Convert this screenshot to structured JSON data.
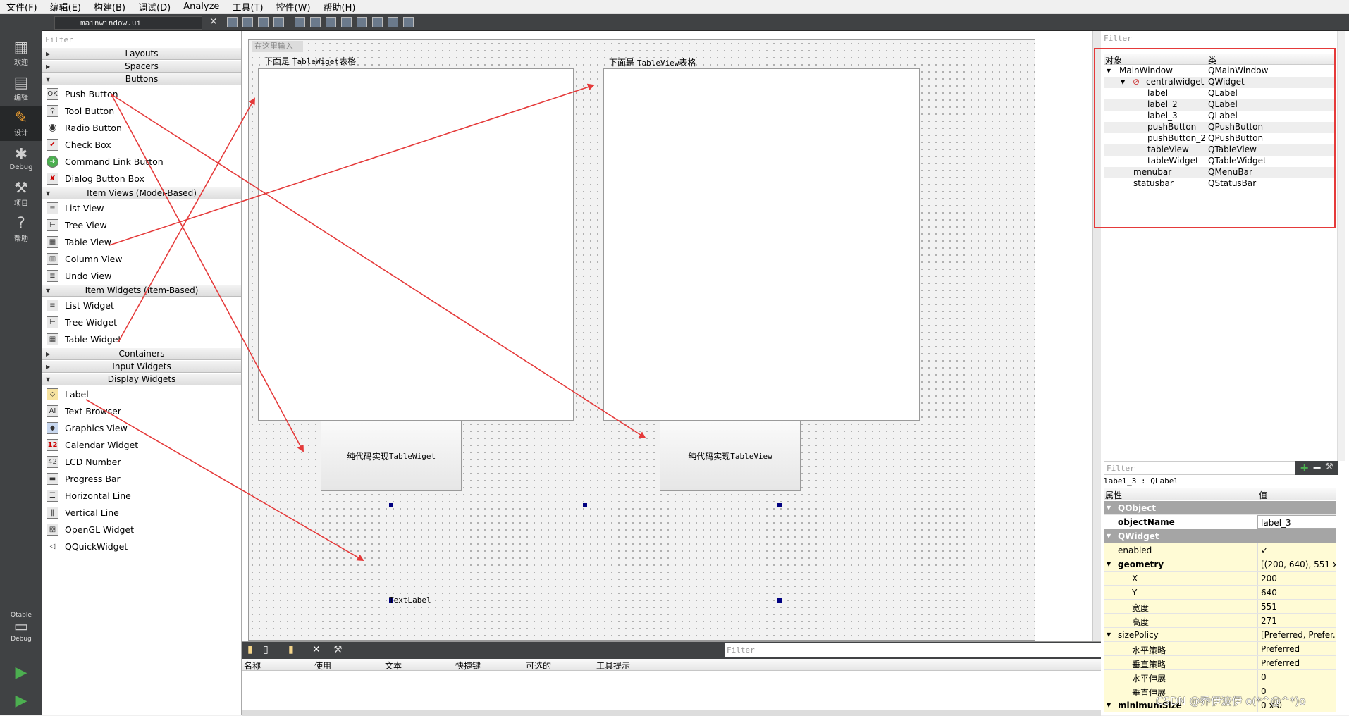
{
  "menus": [
    "文件(F)",
    "编辑(E)",
    "构建(B)",
    "调试(D)",
    "Analyze",
    "工具(T)",
    "控件(W)",
    "帮助(H)"
  ],
  "modes": [
    {
      "label": "欢迎",
      "icon": "welcome-grid-icon"
    },
    {
      "label": "编辑",
      "icon": "edit-doc-icon"
    },
    {
      "label": "设计",
      "icon": "design-pencil-icon",
      "active": true
    },
    {
      "label": "Debug",
      "icon": "debug-bug-icon"
    },
    {
      "label": "项目",
      "icon": "project-wrench-icon"
    },
    {
      "label": "帮助",
      "icon": "help-icon"
    }
  ],
  "kit": {
    "label": "Qtable",
    "sublabel": "Debug"
  },
  "toolbar": {
    "file": "mainwindow.ui"
  },
  "widgetbox": {
    "filter_placeholder": "Filter",
    "categories": {
      "layouts": "Layouts",
      "spacers": "Spacers",
      "buttons": "Buttons",
      "item_views": "Item Views (Model-Based)",
      "item_widgets": "Item Widgets (Item-Based)",
      "containers": "Containers",
      "input_widgets": "Input Widgets",
      "display_widgets": "Display Widgets"
    },
    "buttons": [
      "Push Button",
      "Tool Button",
      "Radio Button",
      "Check Box",
      "Command Link Button",
      "Dialog Button Box"
    ],
    "item_views": [
      "List View",
      "Tree View",
      "Table View",
      "Column View",
      "Undo View"
    ],
    "item_widgets": [
      "List Widget",
      "Tree Widget",
      "Table Widget"
    ],
    "display_widgets": [
      "Label",
      "Text Browser",
      "Graphics View",
      "Calendar Widget",
      "LCD Number",
      "Progress Bar",
      "Horizontal Line",
      "Vertical Line",
      "OpenGL Widget",
      "QQuickWidget"
    ]
  },
  "form": {
    "type_here": "在这里输入",
    "label_left_pre": "下面是 ",
    "label_left_mono": "TableWiget",
    "label_left_post": "表格",
    "label_right_pre": "下面是 ",
    "label_right_mono": "TableView",
    "label_right_post": "表格",
    "button1_pre": "纯代码实现",
    "button1_mono": "TableWiget",
    "button2_pre": "纯代码实现",
    "button2_mono": "TableView",
    "textlabel": "TextLabel"
  },
  "actions": {
    "filter_placeholder": "Filter",
    "columns": [
      "名称",
      "使用",
      "文本",
      "快捷键",
      "可选的",
      "工具提示"
    ]
  },
  "objects": {
    "filter_placeholder": "Filter",
    "header_object": "对象",
    "header_class": "类",
    "rows": [
      {
        "name": "MainWindow",
        "cls": "QMainWindow"
      },
      {
        "name": "centralwidget",
        "cls": "QWidget"
      },
      {
        "name": "label",
        "cls": "QLabel"
      },
      {
        "name": "label_2",
        "cls": "QLabel"
      },
      {
        "name": "label_3",
        "cls": "QLabel"
      },
      {
        "name": "pushButton",
        "cls": "QPushButton"
      },
      {
        "name": "pushButton_2",
        "cls": "QPushButton"
      },
      {
        "name": "tableView",
        "cls": "QTableView"
      },
      {
        "name": "tableWidget",
        "cls": "QTableWidget"
      },
      {
        "name": "menubar",
        "cls": "QMenuBar"
      },
      {
        "name": "statusbar",
        "cls": "QStatusBar"
      }
    ]
  },
  "properties": {
    "filter_placeholder": "Filter",
    "object_class": "label_3 : QLabel",
    "header_property": "属性",
    "header_value": "值",
    "rows": [
      {
        "name": "QObject",
        "value": ""
      },
      {
        "name": "objectName",
        "value": "label_3"
      },
      {
        "name": "QWidget",
        "value": ""
      },
      {
        "name": "enabled",
        "value": "✓"
      },
      {
        "name": "geometry",
        "value": "[(200, 640), 551 x..."
      },
      {
        "name": "X",
        "value": "200"
      },
      {
        "name": "Y",
        "value": "640"
      },
      {
        "name": "宽度",
        "value": "551"
      },
      {
        "name": "高度",
        "value": "271"
      },
      {
        "name": "sizePolicy",
        "value": "[Preferred, Prefer..."
      },
      {
        "name": "水平策略",
        "value": "Preferred"
      },
      {
        "name": "垂直策略",
        "value": "Preferred"
      },
      {
        "name": "水平伸展",
        "value": "0"
      },
      {
        "name": "垂直伸展",
        "value": "0"
      },
      {
        "name": "minimumSize",
        "value": "0 x 0"
      }
    ]
  },
  "colors": {
    "annotation": "#e53a3a",
    "accent": "#f0a030"
  },
  "watermark": "CSDN @乔伊波伊 o(*^@^*)o"
}
